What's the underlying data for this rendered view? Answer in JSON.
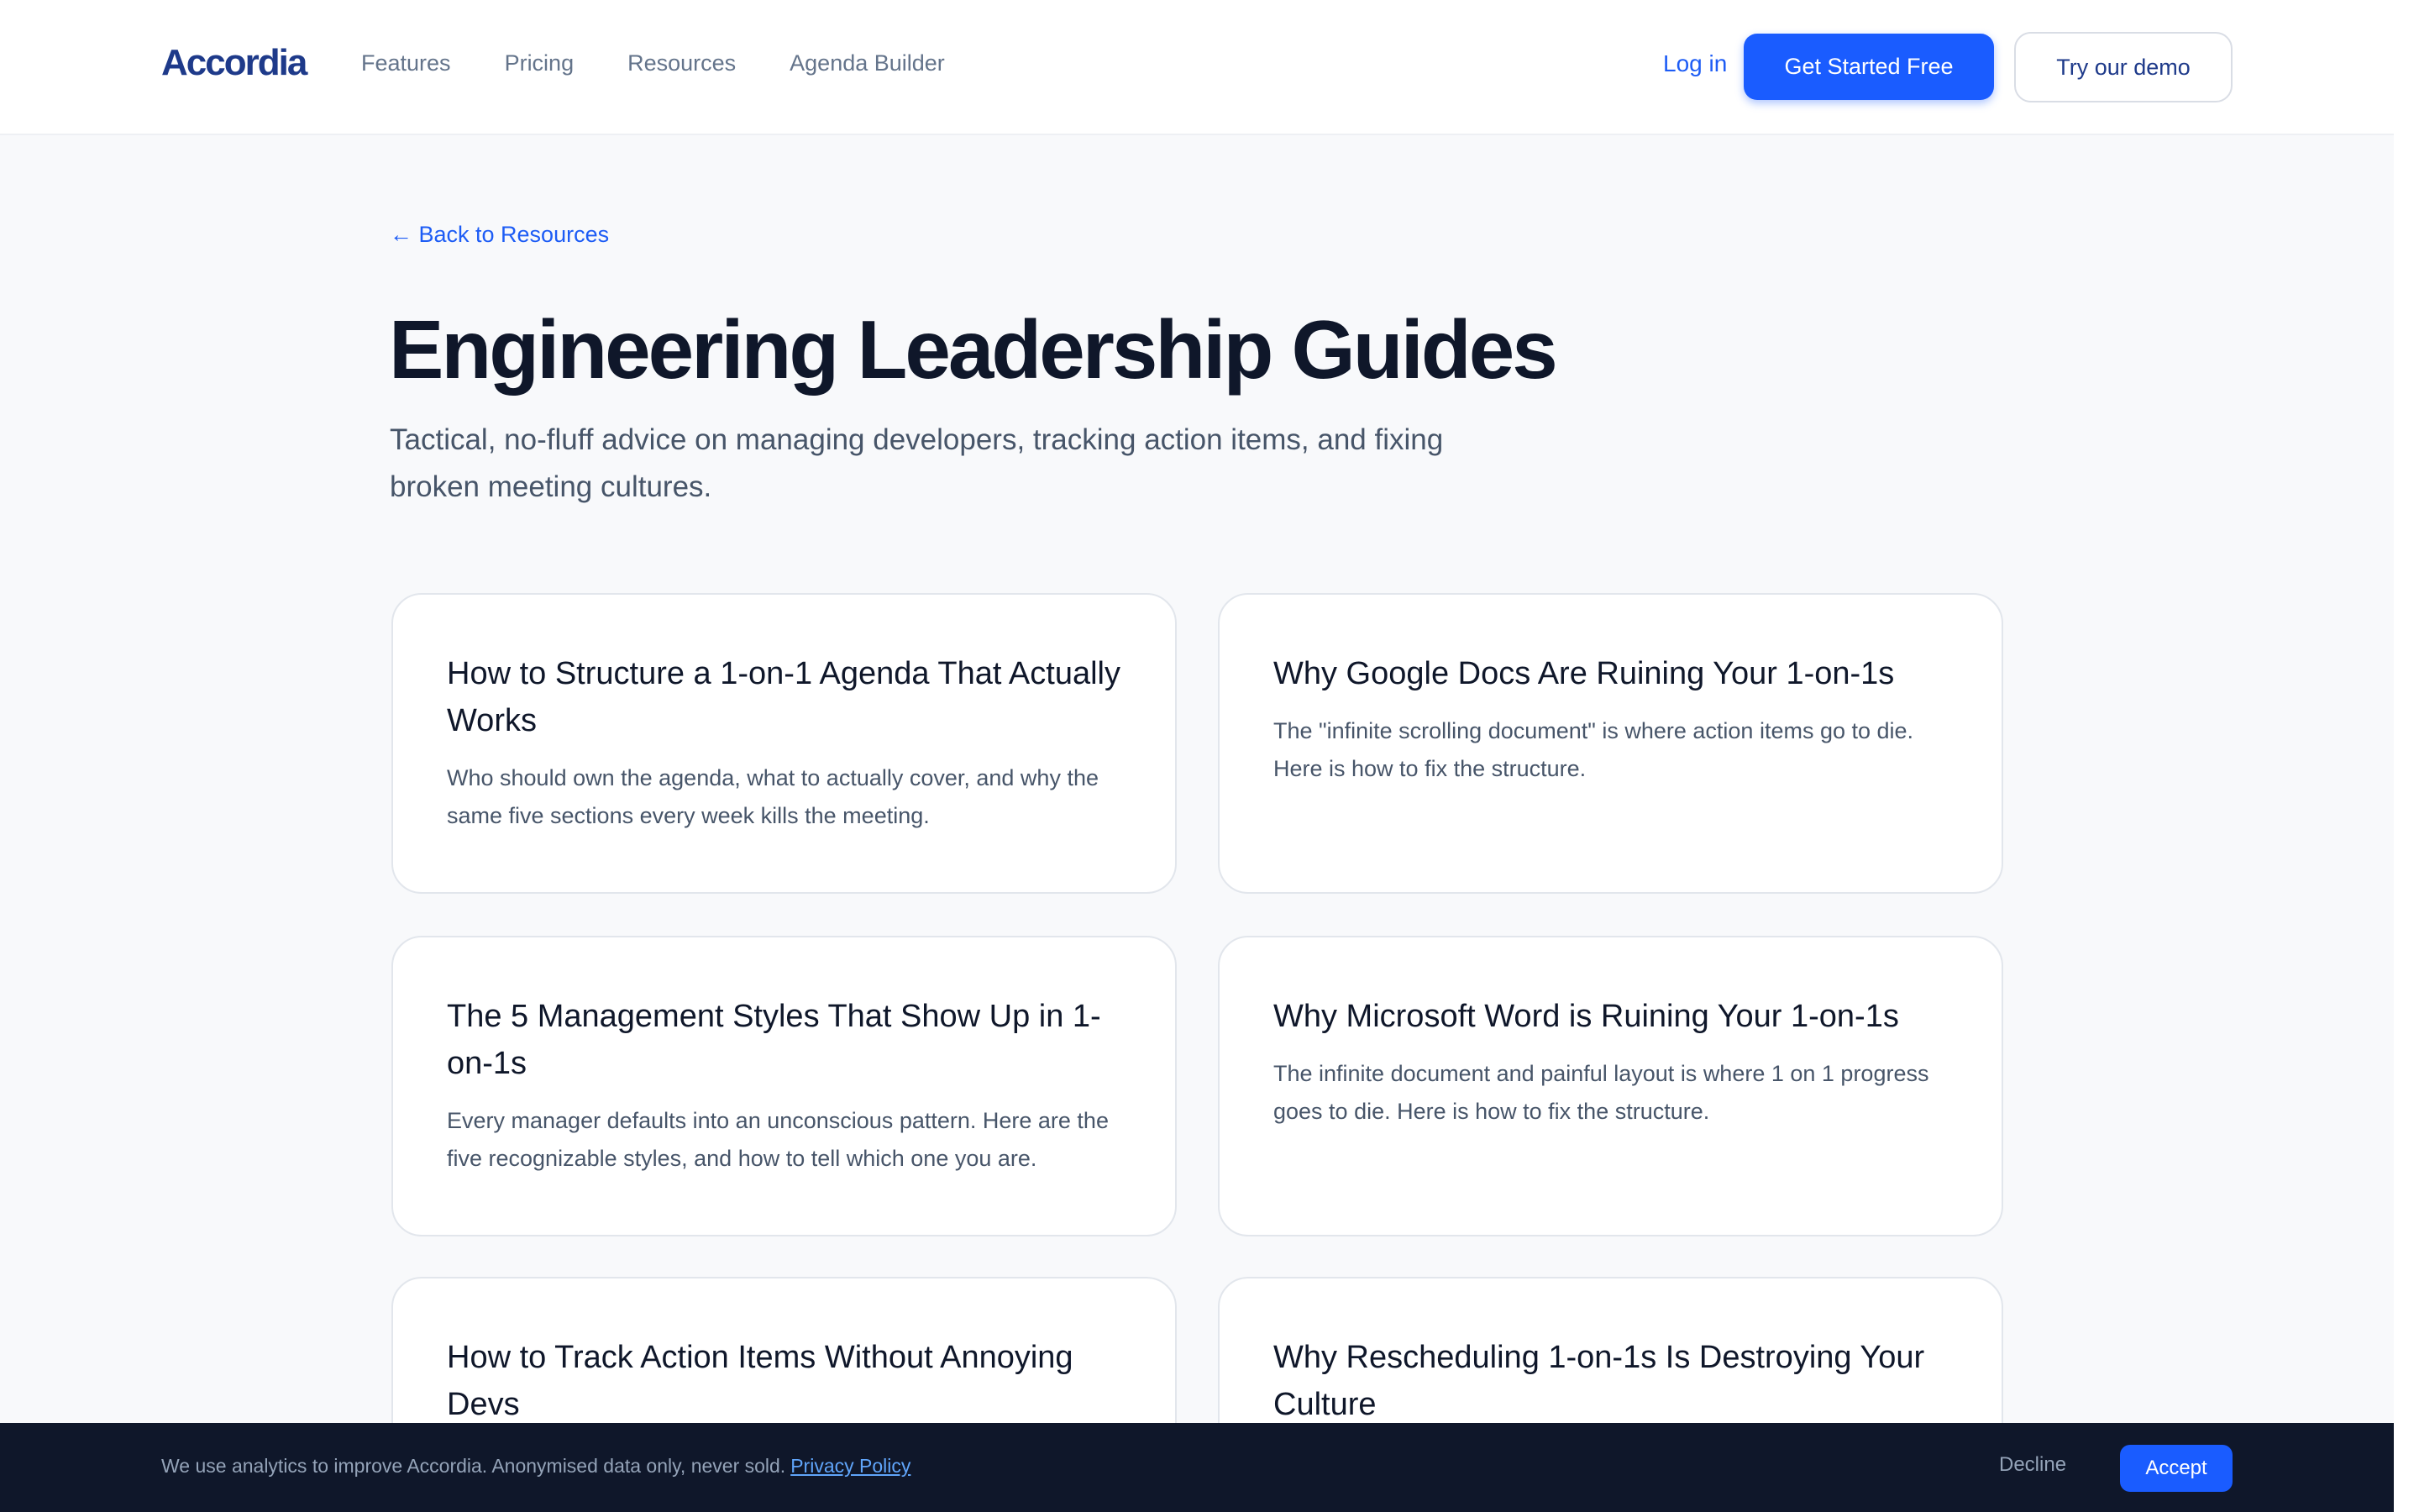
{
  "header": {
    "logo": "Accordia",
    "nav": [
      "Features",
      "Pricing",
      "Resources",
      "Agenda Builder"
    ],
    "login_label": "Log in",
    "cta_primary": "Get Started Free",
    "cta_secondary": "Try our demo"
  },
  "main": {
    "back_link": "← Back to Resources",
    "title": "Engineering Leadership Guides",
    "subtitle": "Tactical, no-fluff advice on managing developers, tracking action items, and fixing broken meeting cultures.",
    "cards": [
      {
        "title": "How to Structure a 1-on-1 Agenda That Actually Works",
        "desc": "Who should own the agenda, what to actually cover, and why the same five sections every week kills the meeting."
      },
      {
        "title": "Why Google Docs Are Ruining Your 1-on-1s",
        "desc": "The \"infinite scrolling document\" is where action items go to die. Here is how to fix the structure."
      },
      {
        "title": "The 5 Management Styles That Show Up in 1-on-1s",
        "desc": "Every manager defaults into an unconscious pattern. Here are the five recognizable styles, and how to tell which one you are."
      },
      {
        "title": "Why Microsoft Word is Ruining Your 1-on-1s",
        "desc": "The infinite document and painful layout is where 1 on 1 progress goes to die. Here is how to fix the structure."
      },
      {
        "title": "How to Track Action Items Without Annoying Devs",
        "desc": ""
      },
      {
        "title": "Why Rescheduling 1-on-1s Is Destroying Your Culture",
        "desc": ""
      }
    ]
  },
  "cookie": {
    "text": "We use analytics to improve Accordia. Anonymised data only, never sold.",
    "link": "Privacy Policy",
    "decline": "Decline",
    "accept": "Accept"
  }
}
